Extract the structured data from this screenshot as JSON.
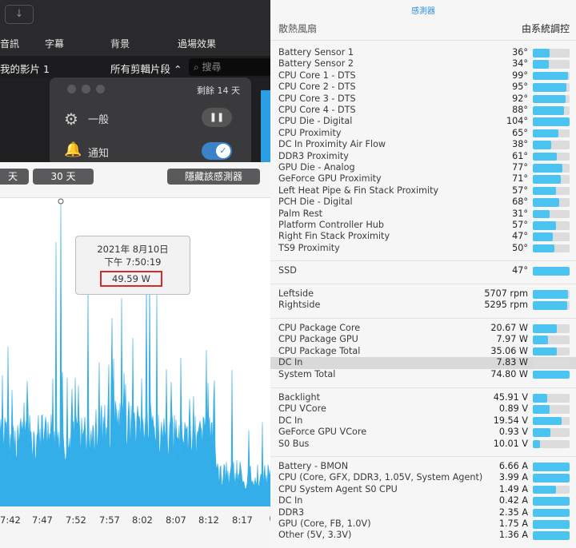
{
  "editor": {
    "arrow_icon": "↓",
    "tabs": [
      "音訊",
      "字幕",
      "背景",
      "過場效果"
    ],
    "row_left": "我的影片 1",
    "row_filter": "所有剪輯片段 ⌃",
    "search_placeholder": "⌕ 搜尋"
  },
  "notification": {
    "remaining": "剩餘 14 天",
    "general_label": "一般",
    "notify_label": "通知",
    "pause_glyph": "❚❚",
    "check_glyph": "✓"
  },
  "graph": {
    "btn_range": "天",
    "btn_30": "30 天",
    "btn_hide": "隱藏該感測器",
    "tooltip_date": "2021年 8月10日",
    "tooltip_time": "下午 7:50:19",
    "tooltip_value": "49.59 W",
    "x_ticks": [
      "7:42",
      "7:47",
      "7:52",
      "7:57",
      "8:02",
      "8:07",
      "8:12",
      "8:17"
    ],
    "color": "#34aee9"
  },
  "panel": {
    "title": "感測器",
    "fan_title": "散熱風扇",
    "fan_mode": "由系統調控",
    "groups": [
      {
        "rows": [
          {
            "label": "Battery Sensor 1",
            "value": "36°",
            "fill": 0.45
          },
          {
            "label": "Battery Sensor 2",
            "value": "34°",
            "fill": 0.43
          },
          {
            "label": "CPU Core 1 - DTS",
            "value": "99°",
            "fill": 0.96
          },
          {
            "label": "CPU Core 2 - DTS",
            "value": "95°",
            "fill": 0.92
          },
          {
            "label": "CPU Core 3 - DTS",
            "value": "92°",
            "fill": 0.89
          },
          {
            "label": "CPU Core 4 - DTS",
            "value": "88°",
            "fill": 0.85
          },
          {
            "label": "CPU Die - Digital",
            "value": "104°",
            "fill": 1.0
          },
          {
            "label": "CPU Proximity",
            "value": "65°",
            "fill": 0.7
          },
          {
            "label": "DC In Proximity Air Flow",
            "value": "38°",
            "fill": 0.5
          },
          {
            "label": "DDR3 Proximity",
            "value": "61°",
            "fill": 0.66
          },
          {
            "label": "GPU Die - Analog",
            "value": "77°",
            "fill": 0.8
          },
          {
            "label": "GeForce GPU Proximity",
            "value": "71°",
            "fill": 0.75
          },
          {
            "label": "Left Heat Pipe & Fin Stack Proximity",
            "value": "57°",
            "fill": 0.62
          },
          {
            "label": "PCH Die - Digital",
            "value": "68°",
            "fill": 0.72
          },
          {
            "label": "Palm Rest",
            "value": "31°",
            "fill": 0.45
          },
          {
            "label": "Platform Controller Hub",
            "value": "57°",
            "fill": 0.62
          },
          {
            "label": "Right Fin Stack Proximity",
            "value": "47°",
            "fill": 0.55
          },
          {
            "label": "TS9 Proximity",
            "value": "50°",
            "fill": 0.58
          }
        ]
      },
      {
        "rows": [
          {
            "label": "SSD",
            "value": "47°",
            "fill": 1.0
          }
        ]
      },
      {
        "rows": [
          {
            "label": "Leftside",
            "value": "5707 rpm",
            "fill": 0.96
          },
          {
            "label": "Rightside",
            "value": "5295 rpm",
            "fill": 0.93
          }
        ]
      },
      {
        "rows": [
          {
            "label": "CPU Package Core",
            "value": "20.67 W",
            "fill": 0.65
          },
          {
            "label": "CPU Package GPU",
            "value": "7.97 W",
            "fill": 0.42
          },
          {
            "label": "CPU Package Total",
            "value": "35.06 W",
            "fill": 0.65
          },
          {
            "label": "DC In",
            "value": "7.83 W",
            "fill": 0.0,
            "highlight": true
          },
          {
            "label": "System Total",
            "value": "74.80 W",
            "fill": 1.0
          }
        ]
      },
      {
        "rows": [
          {
            "label": "Backlight",
            "value": "45.91 V",
            "fill": 0.4
          },
          {
            "label": "CPU VCore",
            "value": "0.89 V",
            "fill": 0.45
          },
          {
            "label": "DC In",
            "value": "19.54 V",
            "fill": 0.78
          },
          {
            "label": "GeForce GPU VCore",
            "value": "0.93 V",
            "fill": 0.47
          },
          {
            "label": "S0 Bus",
            "value": "10.01 V",
            "fill": 0.2
          }
        ]
      },
      {
        "rows": [
          {
            "label": "Battery - BMON",
            "value": "6.66 A",
            "fill": 1.0
          },
          {
            "label": "CPU (Core, GFX, DDR3, 1.05V, System Agent)",
            "value": "3.99 A",
            "fill": 1.0
          },
          {
            "label": "CPU System Agent S0 CPU",
            "value": "1.49 A",
            "fill": 0.62
          },
          {
            "label": "DC In",
            "value": "0.42 A",
            "fill": 1.0
          },
          {
            "label": "DDR3",
            "value": "2.35 A",
            "fill": 1.0
          },
          {
            "label": "GPU (Core, FB, 1.0V)",
            "value": "1.75 A",
            "fill": 1.0
          },
          {
            "label": "Other (5V, 3.3V)",
            "value": "1.36 A",
            "fill": 1.0
          }
        ]
      }
    ]
  }
}
